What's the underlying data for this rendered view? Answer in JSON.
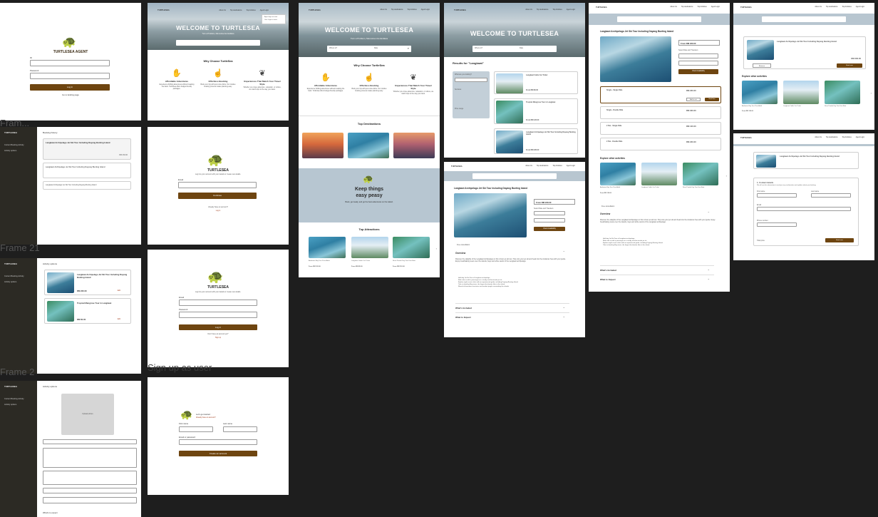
{
  "frame_labels": {
    "frame_a": "Fram...",
    "frame_21": "Frame 21",
    "frame_2": "Frame 2",
    "sign_up": "Sign up as user"
  },
  "brand": "TURTLESEA",
  "agent_login": {
    "title": "TURTLESEA AGENT",
    "id_label": "ID",
    "password_label": "Password",
    "login_button": "Log in",
    "forgot_link": "Go to landing page"
  },
  "nav": {
    "about": "About Us",
    "top_destinations": "Top destinations",
    "top_activities": "Top Activities",
    "agent_login": "Agent Login"
  },
  "hero": {
    "title": "WELCOME TO TURTLESEA",
    "subtitle": "Turn a Problem, Memories Are Endless",
    "where_placeholder": "Where to?",
    "date_placeholder": "Date"
  },
  "dropdown": {
    "item1": "Agent login account",
    "item2": "User Login account"
  },
  "why": {
    "title": "Why Choose TurtleSea",
    "f1_title": "Affordable Adventures",
    "f1_desc": "Experience thrilling adventures without breaking the bank. TurtleSea offers budget-friendly packages.",
    "f2_title": "Effortless Booking",
    "f2_desc": "Book your trip with just a few clicks. Our intuitive booking process makes planning easy.",
    "f3_title": "Experiences That Match Your Travel Style",
    "f3_desc": "Whether you crave adventure, relaxation, or culture, we match trips to the way you travel."
  },
  "top_destinations": "Top Destinations",
  "keep_things": {
    "line1": "Keep things",
    "line2": "easy peasy",
    "desc": "Book, get ready, and go the best adventures on the island."
  },
  "top_attractions": "Top Attractions",
  "attractions": [
    {
      "name": "Andaman Bay Tour Pass Adult",
      "price": "From RM 120.00"
    },
    {
      "name": "Langkawi Cable Car Ticket",
      "price": "From RM 85.00"
    },
    {
      "name": "Nusa Penida Day Tour Fast Boat",
      "price": "From RM 310.00"
    }
  ],
  "results": {
    "title": "Results for \"Langkawi\"",
    "filter_title": "What are you looking?",
    "filter_placeholder": "Enter activity",
    "service_label": "Services",
    "price_label": "Price range",
    "items": [
      {
        "name": "Langkawi Cable Car Ticket",
        "price": "From RM 80.00"
      },
      {
        "name": "Tropical Mangrove Tour in Langkawi",
        "price": "From RM 120.00"
      },
      {
        "name": "Langkawi Archipelago Jet Ski Tour Including Dayang Bunting Island",
        "price": "From RM 230.00"
      }
    ]
  },
  "detail": {
    "title": "Langkawi Archipelago Jet Ski Tour Including Dayang Bunting Island",
    "price_box": "From RM 230.00",
    "date_label": "Select Date and Travelers",
    "date_input": "Start date",
    "travelers_input": "Travelers",
    "check_button": "Check Availability",
    "free_cancel": "Free cancellation",
    "overview": "Overview",
    "overview_text": "Discover the delights of the Langkawi Archipelago on this 4-hour jet ski tour. Hop onto your jet ski and head into the Andaman Sea with your guide. Enjoy breathtaking views over the islands, bays and white sands of the Langkawi archipelago.",
    "bullets": [
      "Half-day Jet Ski Tour of Langkawi archipelago",
      "Ride solo or with a passenger on a sturdy and fun-to-ride jet ski",
      "Explore eight scenic islets with an experienced guide, including Dayang Bunting Island",
      "Take in dazzling Bay views, the largest freshwater lake in the island",
      "Marvel at limestone structures and verdant jungle surrounding the islands"
    ],
    "whats_included": "What's Included",
    "what_expect": "What to Expect",
    "packages": [
      {
        "name": "Single - Single Ride",
        "price": "RM 230.00"
      },
      {
        "name": "Single - Double Ride",
        "price": "RM 320.00"
      },
      {
        "name": "2 Pax - Single Ride",
        "price": "RM 130.00"
      },
      {
        "name": "2 Pax - Double Ride",
        "price": "RM 230.00"
      }
    ],
    "add_cart": "Add to cart",
    "book_now": "Book Now",
    "explore_title": "Explore other activities",
    "explore": [
      {
        "name": "Andaman Bay Tour Pass Adult",
        "price": "From RM 120.00"
      },
      {
        "name": "Langkawi Cable Car Ticket",
        "price": "From RM 85.00"
      },
      {
        "name": "Nusa Penida Day Tour Fast Boat",
        "price": "From RM 310.00"
      }
    ]
  },
  "booking": {
    "header": "Booking history",
    "item1": "Langkawi Archipelago Jet Ski Tour Including Dayang Bunting Island",
    "item2": "Langkawi Archipelago Jet Ski Tour Including Dayang Bunting Island",
    "price": "RM 230.00"
  },
  "cart_frame": {
    "title": "Langkawi Archipelago Jet Ski Tour Including Dayang Bunting Island",
    "price": "RM 230.00",
    "remove": "Remove",
    "book_now": "Book now",
    "explore": "Explore other activities"
  },
  "checkout": {
    "title": "Langkawi Archipelago Jet Ski Tour Including Dayang Bunting Island",
    "contact": "1. Contact details",
    "contact_desc": "We will use this information to send you any confirmation and updates about your booking.",
    "first_name": "First name",
    "last_name": "Last name",
    "email": "Email",
    "phone": "Phone number",
    "price_label": "Total price",
    "next_button": "Book now"
  },
  "forgot": {
    "title": "TURTLESEA",
    "desc": "Log into your account with your details or create new details.",
    "email": "Email",
    "continue": "Continue",
    "already": "Already have an account?",
    "login": "Log in"
  },
  "user_login": {
    "desc": "Log into your account with your details or create new details.",
    "email": "Email",
    "password": "Password",
    "login": "Log in",
    "no_account": "Don't have an account yet?",
    "signup": "Sign up"
  },
  "signup": {
    "line1": "Let's get started",
    "line2": "Already have an account?",
    "first": "First name",
    "last": "Last name",
    "email": "Email or password",
    "button": "Create an account"
  },
  "admin_list": {
    "header": "Activity options",
    "sidebar1": "Current Booking Activity",
    "sidebar2": "Activity options",
    "card1": "Langkawi Archipelago Jet Ski Tour Including Dayang Bunting Island",
    "card2": "Tropical Mangrove Tour in Langkawi",
    "price1": "RM 230.00",
    "price2": "RM 60.00",
    "edit": "Edit"
  },
  "admin_form": {
    "header": "Activity options",
    "upload": "Upload picture",
    "package_name": "Package name",
    "overview": "Overview",
    "whats_included": "What's included",
    "address": "Address / point",
    "price": "Price point",
    "whats_expect": "What's to expect"
  }
}
